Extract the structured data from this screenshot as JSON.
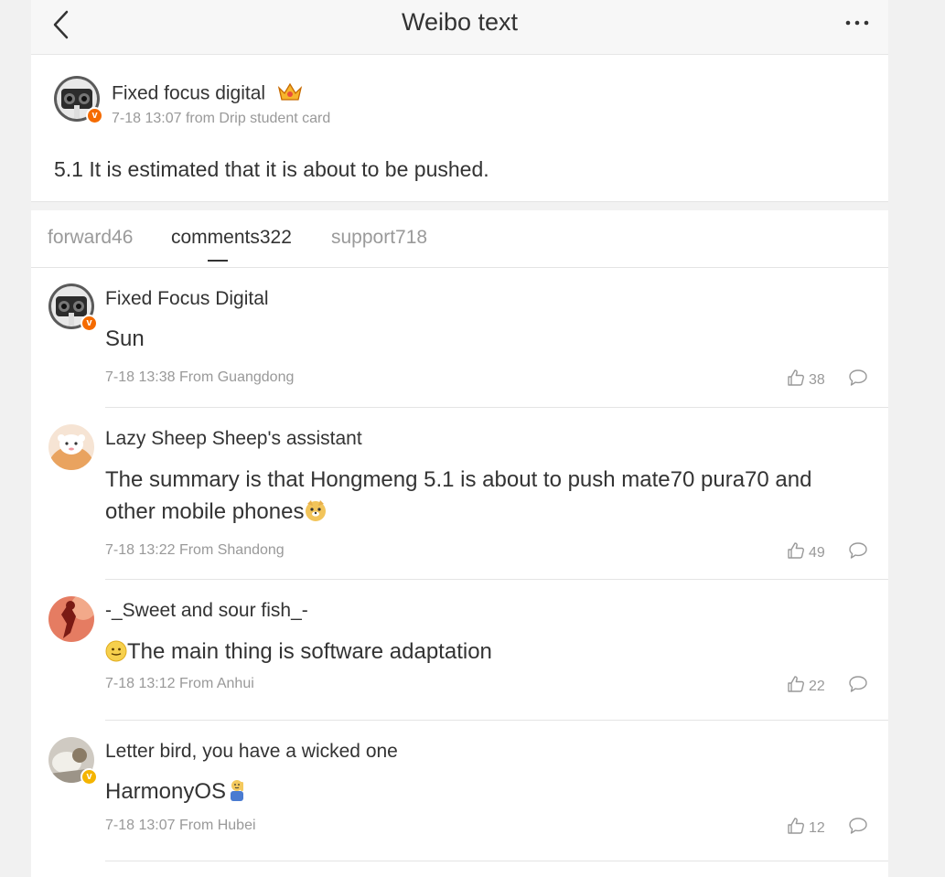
{
  "header": {
    "title": "Weibo text",
    "back_icon": "chevron-left-icon",
    "more_icon": "more-dots-icon"
  },
  "post": {
    "author": "Fixed focus digital",
    "meta": "7-18 13:07 from Drip student card",
    "text": "5.1 It is estimated that it is about to be pushed.",
    "badge_color": "#f56b00"
  },
  "tabs": [
    {
      "label": "forward46"
    },
    {
      "label": "comments322",
      "active": true
    },
    {
      "label": "support718"
    }
  ],
  "comments": [
    {
      "name": "Fixed Focus Digital",
      "text": "Sun",
      "meta": "7-18 13:38 From Guangdong",
      "likes": "38",
      "badge": "orange"
    },
    {
      "name": "Lazy Sheep Sheep's assistant",
      "text": "The summary is that Hongmeng 5.1 is about to push mate70 pura70 and other mobile phones",
      "meta": "7-18 13:22 From Shandong",
      "likes": "49"
    },
    {
      "name": "-_Sweet and sour fish_-",
      "text": "The main thing is software adaptation",
      "meta": "7-18 13:12 From Anhui",
      "likes": "22"
    },
    {
      "name": "Letter bird, you have a wicked one",
      "text": "HarmonyOS",
      "meta": "7-18 13:07 From Hubei",
      "likes": "12",
      "badge": "yellow"
    }
  ],
  "colors": {
    "orange_badge": "#f56b00",
    "yellow_badge": "#f4b400",
    "muted_text": "#999999",
    "tab_inactive": "#9a9a9a"
  }
}
